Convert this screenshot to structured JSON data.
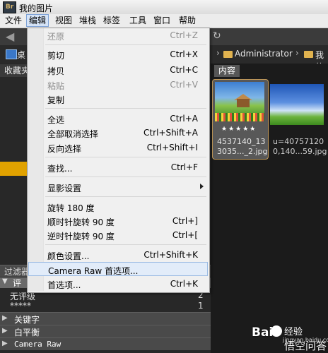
{
  "window": {
    "app_logo": "Br",
    "title": "我的图片"
  },
  "menubar": [
    {
      "label": "文件",
      "active": false
    },
    {
      "label": "编辑",
      "active": true
    },
    {
      "label": "视图",
      "active": false
    },
    {
      "label": "堆栈",
      "active": false
    },
    {
      "label": "标签",
      "active": false
    },
    {
      "label": "工具",
      "active": false
    },
    {
      "label": "窗口",
      "active": false
    },
    {
      "label": "帮助",
      "active": false
    }
  ],
  "edit_menu": [
    {
      "label": "还原",
      "shortcut": "Ctrl+Z",
      "enabled": false
    },
    {
      "label": "剪切",
      "shortcut": "Ctrl+X",
      "enabled": true
    },
    {
      "label": "拷贝",
      "shortcut": "Ctrl+C",
      "enabled": true
    },
    {
      "label": "粘贴",
      "shortcut": "Ctrl+V",
      "enabled": false
    },
    {
      "label": "复制",
      "shortcut": "",
      "enabled": true
    },
    {
      "label": "全选",
      "shortcut": "Ctrl+A",
      "enabled": true
    },
    {
      "label": "全部取消选择",
      "shortcut": "Ctrl+Shift+A",
      "enabled": true
    },
    {
      "label": "反向选择",
      "shortcut": "Ctrl+Shift+I",
      "enabled": true
    },
    {
      "label": "查找...",
      "shortcut": "Ctrl+F",
      "enabled": true
    },
    {
      "label": "显影设置",
      "shortcut": "",
      "enabled": true,
      "submenu": true
    },
    {
      "label": "旋转 180 度",
      "shortcut": "",
      "enabled": true
    },
    {
      "label": "顺时针旋转 90 度",
      "shortcut": "Ctrl+]",
      "enabled": true
    },
    {
      "label": "逆时针旋转 90 度",
      "shortcut": "Ctrl+[",
      "enabled": true
    },
    {
      "label": "颜色设置...",
      "shortcut": "Ctrl+Shift+K",
      "enabled": true
    },
    {
      "label": "Camera Raw 首选项...",
      "shortcut": "",
      "enabled": true,
      "highlighted": true
    },
    {
      "label": "首选项...",
      "shortcut": "Ctrl+K",
      "enabled": true
    }
  ],
  "pathbar": {
    "fragment": "桌",
    "folder1": "Administrator",
    "folder2": "我的"
  },
  "left_panel": {
    "favorites_tab": "收藏夹",
    "filter_header": "过滤器",
    "rating_section": "评",
    "rows": [
      {
        "label": "无评级",
        "count": "2"
      },
      {
        "label": "*****",
        "count": "1"
      }
    ],
    "sections": [
      "关键字",
      "白平衡",
      "Camera Raw"
    ]
  },
  "content": {
    "tab": "内容",
    "thumbnails": [
      {
        "stars": "★★★★★",
        "name_line1": "4537140_13",
        "name_line2": "3035..._2.jpg",
        "selected": true
      },
      {
        "stars": "",
        "name_line1": "u=40757120",
        "name_line2": "0,140...59.jpg",
        "selected": false
      }
    ]
  },
  "watermark": {
    "brand": "Bai",
    "jingyan": "经验",
    "url": "jingyan.baidu.com",
    "qa": "悟空问答"
  }
}
